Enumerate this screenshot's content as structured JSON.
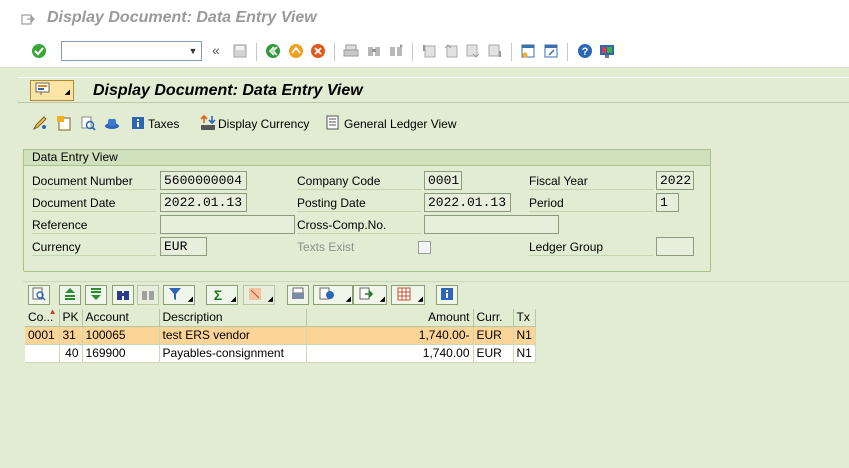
{
  "window": {
    "title": "Display Document: Data Entry View"
  },
  "system_toolbar": {
    "command_field_value": "",
    "back_label": "«"
  },
  "page": {
    "title": "Display Document: Data Entry View"
  },
  "app_toolbar": {
    "taxes_label": "Taxes",
    "display_currency_label": "Display Currency",
    "general_ledger_view_label": "General Ledger View"
  },
  "header_group": {
    "title": "Data Entry View",
    "document_number_label": "Document Number",
    "document_number": "5600000004",
    "company_code_label": "Company Code",
    "company_code": "0001",
    "fiscal_year_label": "Fiscal Year",
    "fiscal_year": "2022",
    "document_date_label": "Document Date",
    "document_date": "2022.01.13",
    "posting_date_label": "Posting Date",
    "posting_date": "2022.01.13",
    "period_label": "Period",
    "period": "1",
    "reference_label": "Reference",
    "reference": "",
    "cross_comp_label": "Cross-Comp.No.",
    "cross_comp": "",
    "currency_label": "Currency",
    "currency": "EUR",
    "texts_exist_label": "Texts Exist",
    "texts_exist_checked": false,
    "ledger_group_label": "Ledger Group",
    "ledger_group": ""
  },
  "items_table": {
    "columns": [
      "Co...",
      "PK",
      "Account",
      "Description",
      "Amount",
      "Curr.",
      "Tx"
    ],
    "rows": [
      {
        "co": "0001",
        "pk": "31",
        "account": "100065",
        "description": "test ERS vendor",
        "amount": "1,740.00-",
        "curr": "EUR",
        "tx": "N1",
        "selected": true
      },
      {
        "co": "",
        "pk": "40",
        "account": "169900",
        "description": "Payables-consignment",
        "amount": "1,740.00",
        "curr": "EUR",
        "tx": "N1",
        "selected": false
      }
    ]
  },
  "colors": {
    "background": "#e1ecd2",
    "selected_row": "#fbd597",
    "title_grey": "#9a9a9a"
  }
}
